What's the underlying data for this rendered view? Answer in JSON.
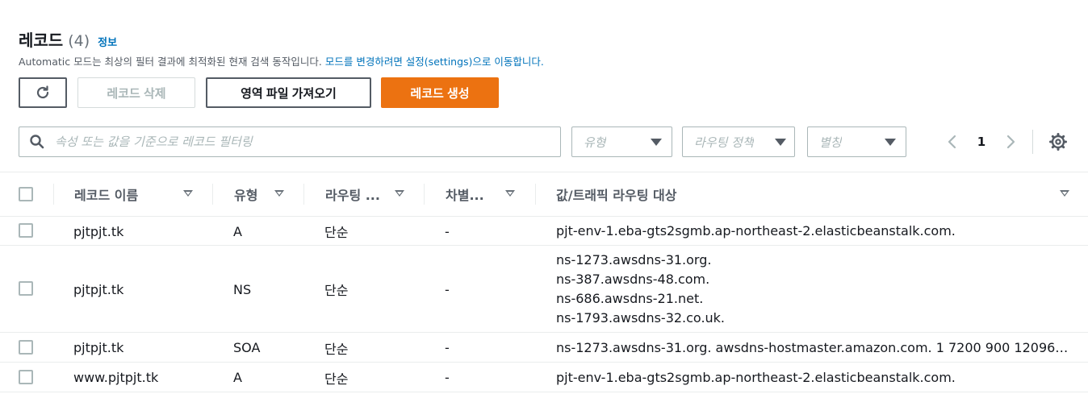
{
  "header": {
    "title": "레코드",
    "count": "(4)",
    "info_link": "정보",
    "description_text": "Automatic 모드는 최상의 필터 결과에 최적화된 현재 검색 동작입니다.",
    "description_link": "모드를 변경하려면 설정(settings)으로 이동합니다."
  },
  "toolbar": {
    "delete_label": "레코드 삭제",
    "import_label": "영역 파일 가져오기",
    "create_label": "레코드 생성"
  },
  "filters": {
    "search_placeholder": "속성 또는 값을 기준으로 레코드 필터링",
    "type_placeholder": "유형",
    "routing_placeholder": "라우팅 정책",
    "alias_placeholder": "별칭"
  },
  "pagination": {
    "current_page": "1"
  },
  "table": {
    "columns": [
      "레코드 이름",
      "유형",
      "라우팅 ...",
      "차별...",
      "값/트래픽 라우팅 대상"
    ],
    "rows": [
      {
        "name": "pjtpjt.tk",
        "type": "A",
        "routing": "단순",
        "diff": "-",
        "values": [
          "pjt-env-1.eba-gts2sgmb.ap-northeast-2.elasticbeanstalk.com."
        ]
      },
      {
        "name": "pjtpjt.tk",
        "type": "NS",
        "routing": "단순",
        "diff": "-",
        "values": [
          "ns-1273.awsdns-31.org.",
          "ns-387.awsdns-48.com.",
          "ns-686.awsdns-21.net.",
          "ns-1793.awsdns-32.co.uk."
        ]
      },
      {
        "name": "pjtpjt.tk",
        "type": "SOA",
        "routing": "단순",
        "diff": "-",
        "values": [
          "ns-1273.awsdns-31.org. awsdns-hostmaster.amazon.com. 1 7200 900 12096…"
        ]
      },
      {
        "name": "www.pjtpjt.tk",
        "type": "A",
        "routing": "단순",
        "diff": "-",
        "values": [
          "pjt-env-1.eba-gts2sgmb.ap-northeast-2.elasticbeanstalk.com."
        ]
      }
    ]
  },
  "colors": {
    "primary": "#ec7211",
    "link": "#0073bb",
    "border": "#aab7b8"
  },
  "icons": [
    "refresh-icon",
    "search-icon",
    "chevron-left-icon",
    "chevron-right-icon",
    "settings-icon",
    "sort-icon"
  ]
}
